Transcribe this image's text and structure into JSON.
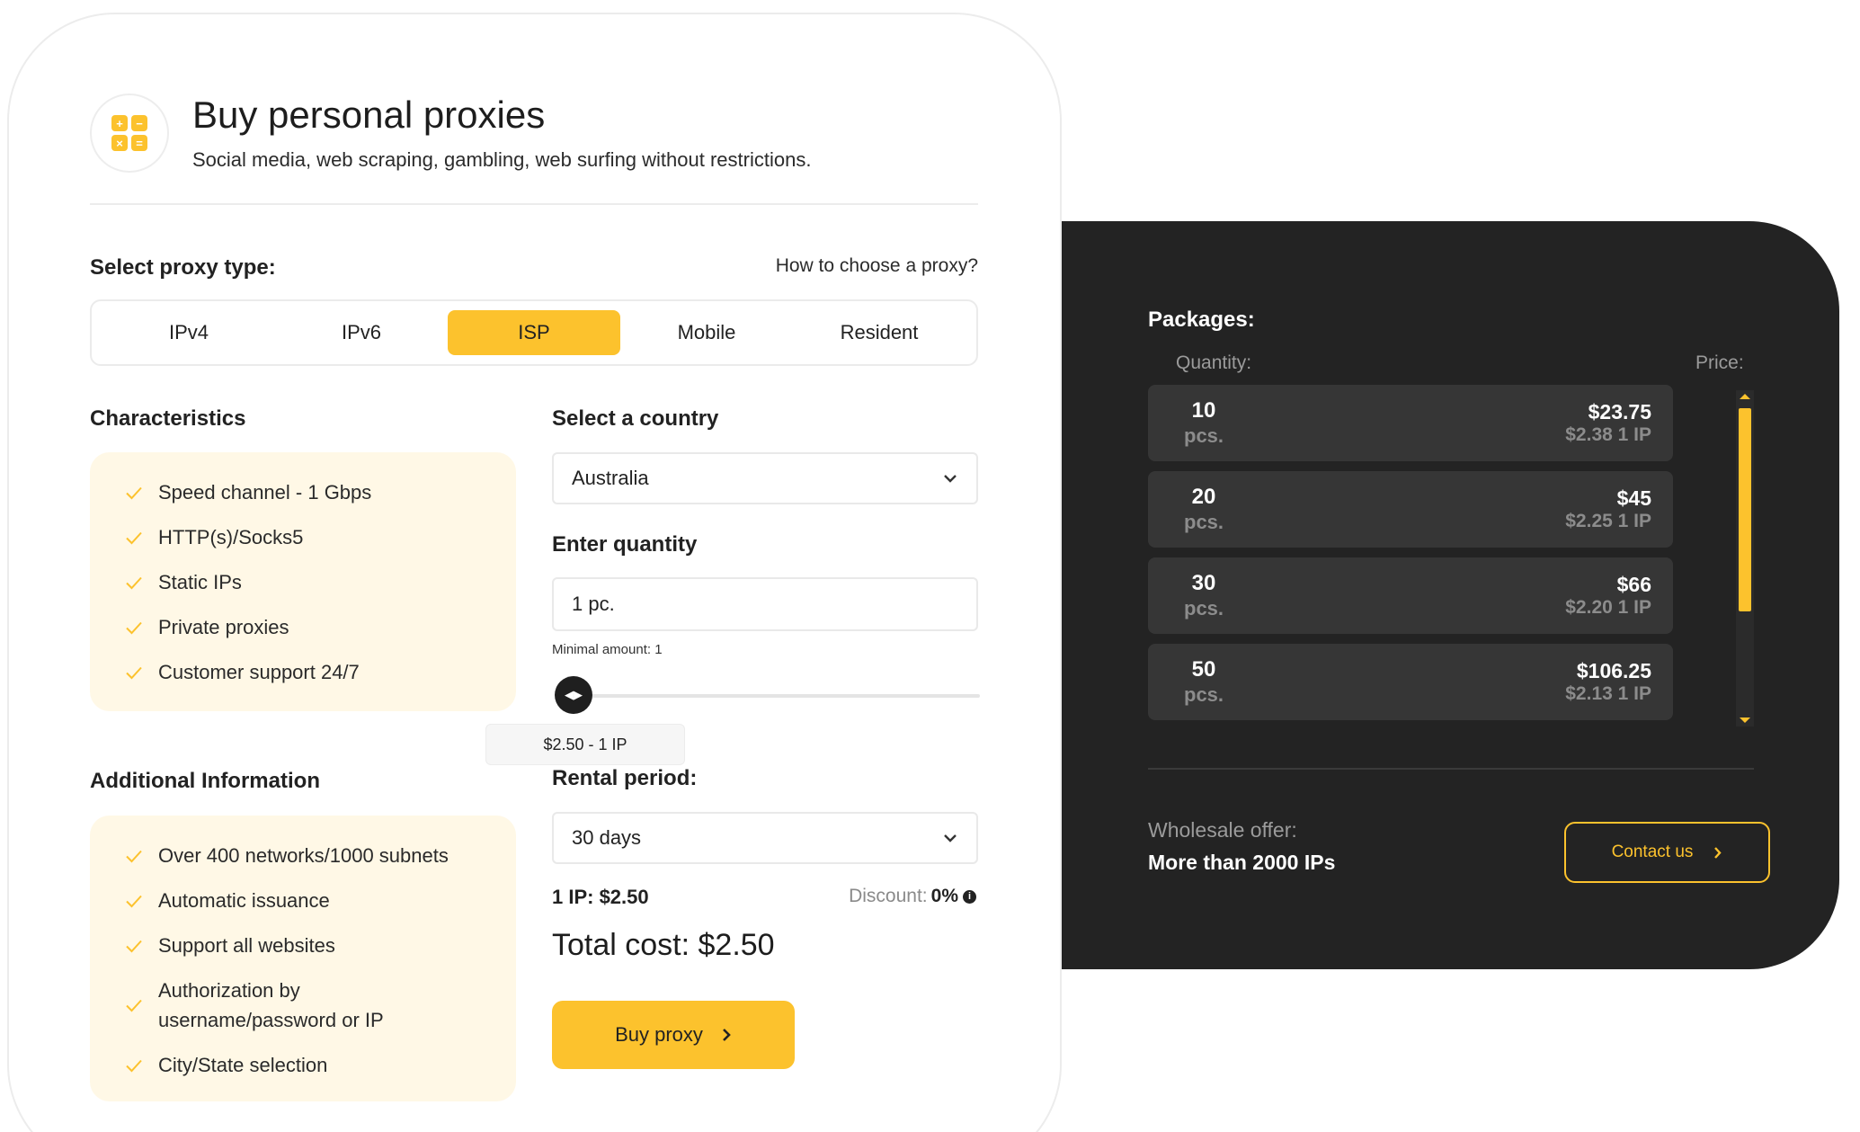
{
  "header": {
    "title": "Buy personal proxies",
    "subtitle": "Social media, web scraping, gambling, web surfing without restrictions.",
    "logo_icon": "calculator-icon"
  },
  "proxy_type": {
    "label": "Select proxy type:",
    "help_link": "How to choose a proxy?",
    "tabs": [
      {
        "label": "IPv4",
        "active": false
      },
      {
        "label": "IPv6",
        "active": false
      },
      {
        "label": "ISP",
        "active": true
      },
      {
        "label": "Mobile",
        "active": false
      },
      {
        "label": "Resident",
        "active": false
      }
    ]
  },
  "characteristics": {
    "title": "Characteristics",
    "items": [
      "Speed channel - 1 Gbps",
      "HTTP(s)/Socks5",
      "Static IPs",
      "Private proxies",
      "Customer support 24/7"
    ]
  },
  "additional": {
    "title": "Additional Information",
    "items": [
      "Over 400 networks/1000 subnets",
      "Automatic issuance",
      "Support all websites",
      "Authorization by username/password or IP",
      "City/State selection"
    ]
  },
  "country": {
    "label": "Select a country",
    "value": "Australia"
  },
  "quantity": {
    "label": "Enter quantity",
    "value": "1 pc.",
    "minimal": "Minimal amount: 1",
    "slider_fraction": 0.0,
    "tooltip": "$2.50 - 1 IP"
  },
  "rental": {
    "label": "Rental period:",
    "value": "30 days"
  },
  "pricing": {
    "ip_price": "1 IP: $2.50",
    "discount_label": "Discount:",
    "discount_value": "0%",
    "total": "Total cost: $2.50",
    "buy_label": "Buy proxy"
  },
  "packages": {
    "title": "Packages:",
    "col_quantity": "Quantity:",
    "col_price": "Price:",
    "items": [
      {
        "qty": "10",
        "unit": "pcs.",
        "total": "$23.75",
        "each": "$2.38 1 IP"
      },
      {
        "qty": "20",
        "unit": "pcs.",
        "total": "$45",
        "each": "$2.25 1 IP"
      },
      {
        "qty": "30",
        "unit": "pcs.",
        "total": "$66",
        "each": "$2.20 1 IP"
      },
      {
        "qty": "50",
        "unit": "pcs.",
        "total": "$106.25",
        "each": "$2.13 1 IP"
      }
    ]
  },
  "wholesale": {
    "label": "Wholesale offer:",
    "value": "More than 2000 IPs",
    "contact_label": "Contact us"
  },
  "colors": {
    "accent": "#fcc22d",
    "dark_panel": "#232323",
    "package_row": "#363636",
    "box_bg": "#fff8e6"
  }
}
